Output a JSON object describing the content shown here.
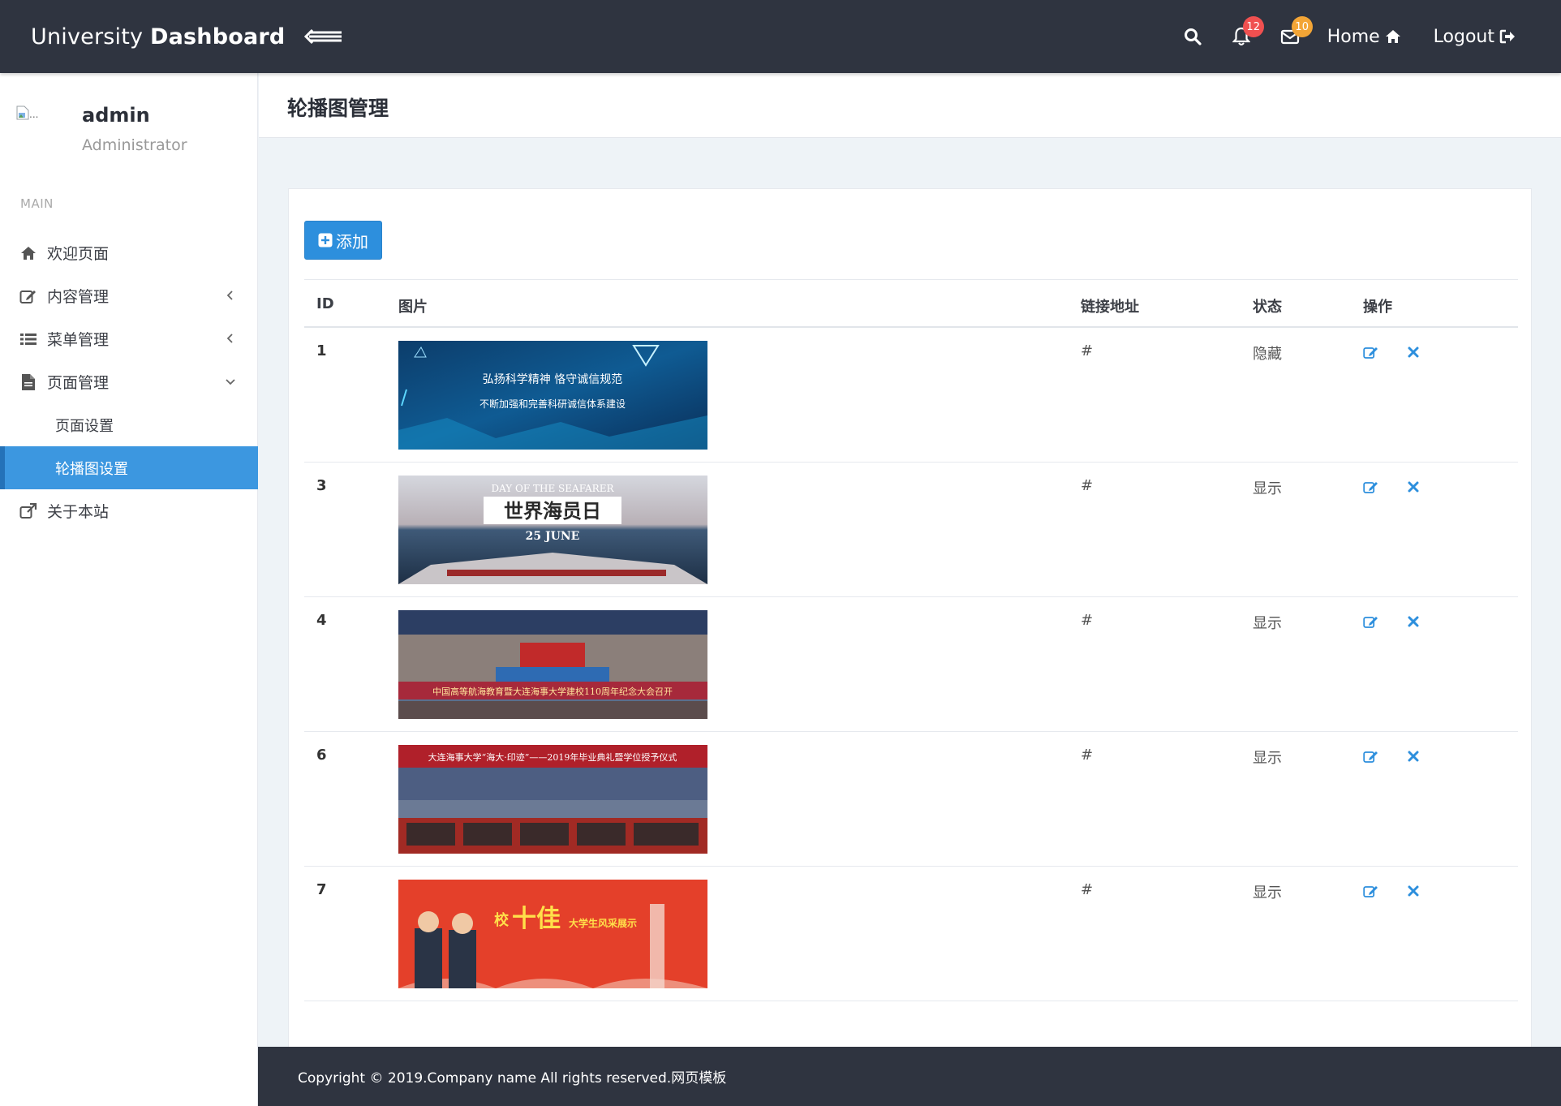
{
  "header": {
    "brand_light": "University ",
    "brand_bold": "Dashboard",
    "notifications_count": "12",
    "messages_count": "10",
    "home_label": "Home",
    "logout_label": "Logout"
  },
  "user": {
    "name": "admin",
    "role": "Administrator",
    "avatar_alt": "..."
  },
  "sidebar": {
    "section": "MAIN",
    "items": [
      {
        "label": "欢迎页面",
        "icon": "home-icon"
      },
      {
        "label": "内容管理",
        "icon": "edit-icon"
      },
      {
        "label": "菜单管理",
        "icon": "list-icon"
      },
      {
        "label": "页面管理",
        "icon": "file-icon"
      },
      {
        "label": "页面设置"
      },
      {
        "label": "轮播图设置"
      },
      {
        "label": "关于本站",
        "icon": "external-link-icon"
      }
    ]
  },
  "page": {
    "title": "轮播图管理",
    "add_button": "添加"
  },
  "table": {
    "headers": [
      "ID",
      "图片",
      "链接地址",
      "状态",
      "操作"
    ],
    "rows": [
      {
        "id": "1",
        "link": "#",
        "status": "隐藏",
        "banner": {
          "line1": "弘扬科学精神  恪守诚信规范",
          "line2": "不断加强和完善科研诚信体系建设"
        }
      },
      {
        "id": "3",
        "link": "#",
        "status": "显示",
        "banner": {
          "line1": "DAY OF THE SEAFARER",
          "line2": "世界海员日",
          "line3": "25 JUNE"
        }
      },
      {
        "id": "4",
        "link": "#",
        "status": "显示",
        "banner": {
          "line1": "中国高等航海教育暨大连海事大学建校110周年纪念大会召开"
        }
      },
      {
        "id": "6",
        "link": "#",
        "status": "显示",
        "banner": {
          "line1": "大连海事大学“海大·印迹”——2019年毕业典礼暨学位授予仪式"
        }
      },
      {
        "id": "7",
        "link": "#",
        "status": "显示",
        "banner": {
          "line1": "十佳",
          "line2": "大学生风采展示",
          "line3": "校"
        }
      }
    ]
  },
  "footer": {
    "text": "Copyright © 2019.Company name All rights reserved.网页模板"
  },
  "colors": {
    "topbar": "#2f3440",
    "accent": "#3c97e0",
    "action_icon": "#2d8fdd"
  }
}
